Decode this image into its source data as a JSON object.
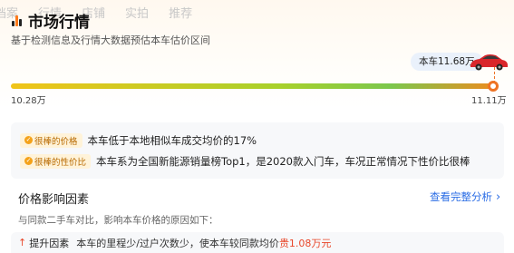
{
  "top_tabs": [
    "档案",
    "行情",
    "店铺",
    "实拍",
    "推荐"
  ],
  "header": {
    "title": "市场行情",
    "subtitle": "基于检测信息及行情大数据预估本车估价区间"
  },
  "price": {
    "tag": "本车11.68万",
    "range_min": "10.28万",
    "range_max": "11.11万",
    "position_fraction": 1.0
  },
  "insights": [
    {
      "badge": "很棒的价格",
      "text": "本车低于本地相似车成交均价的17%"
    },
    {
      "badge": "很棒的性价比",
      "text": "本车系为全国新能源销量榜Top1，是2020款入门车，车况正常情况下性价比很棒"
    }
  ],
  "factors": {
    "heading": "价格影响因素",
    "link": "查看完整分析",
    "description": "与同款二手车对比，影响本车价格的原因如下：",
    "row": {
      "label": "提升因素",
      "text": "本车的里程少/过户次数少，使本车较同款均价",
      "highlight": "贵1.08万元"
    }
  },
  "colors": {
    "accent": "#ee7324",
    "link": "#2b6de5",
    "highlight": "#e8472b"
  }
}
